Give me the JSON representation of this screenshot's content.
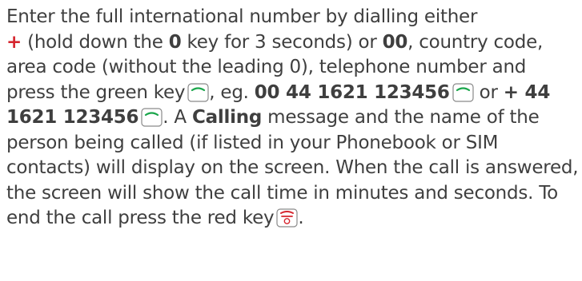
{
  "paragraph": {
    "s1": "Enter the full international number by dialling either",
    "plus_sign": "+",
    "s2": " (hold down the ",
    "zero_key": "0",
    "s3": " key for 3 seconds) or ",
    "double_zero": "00",
    "s4": ", country code, area code (without the leading 0), telephone number and press the green key",
    "s5": ", eg. ",
    "example1": "00 44 1621 123456",
    "s6": " or ",
    "example2": "+ 44 1621 123456",
    "s7": ". A ",
    "calling": "Calling",
    "s8": " message and the name of the person being called (if listed in your Phonebook or SIM contacts) will display on the screen. When the call is answered, the screen will show the call time in minutes and seconds. To end the call press the red key",
    "s9": "."
  },
  "icons": {
    "call_key": "green-call-key-icon",
    "end_key": "red-end-key-icon"
  },
  "colors": {
    "text": "#3f3f3f",
    "plus": "#d6262f",
    "call_key_line": "#1aa64b",
    "end_key_line": "#d6262f"
  }
}
